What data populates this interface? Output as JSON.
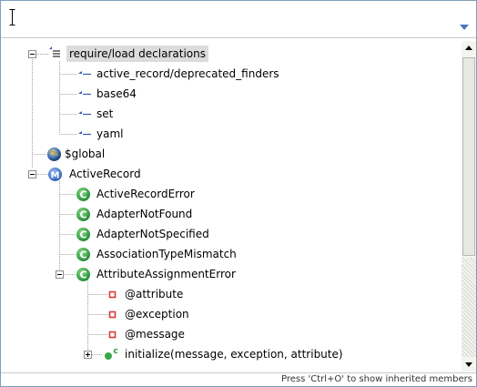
{
  "filter": {
    "value": "",
    "placeholder": ""
  },
  "tree": {
    "nodes": [
      {
        "label": "require/load declarations",
        "icon": "imports-container-icon",
        "selected": true
      },
      {
        "label": "active_record/deprecated_finders",
        "icon": "import-icon"
      },
      {
        "label": "base64",
        "icon": "import-icon"
      },
      {
        "label": "set",
        "icon": "import-icon"
      },
      {
        "label": "yaml",
        "icon": "import-icon"
      },
      {
        "label": "$global",
        "icon": "global-icon"
      },
      {
        "label": "ActiveRecord",
        "icon": "module-icon",
        "badge": "M"
      },
      {
        "label": "ActiveRecordError",
        "icon": "class-icon",
        "badge": "C"
      },
      {
        "label": "AdapterNotFound",
        "icon": "class-icon",
        "badge": "C"
      },
      {
        "label": "AdapterNotSpecified",
        "icon": "class-icon",
        "badge": "C"
      },
      {
        "label": "AssociationTypeMismatch",
        "icon": "class-icon",
        "badge": "C"
      },
      {
        "label": "AttributeAssignmentError",
        "icon": "class-icon",
        "badge": "C"
      },
      {
        "label": "@attribute",
        "icon": "field-icon"
      },
      {
        "label": "@exception",
        "icon": "field-icon"
      },
      {
        "label": "@message",
        "icon": "field-icon"
      },
      {
        "label": "initialize(message, exception, attribute)",
        "icon": "constructor-icon",
        "badge": "c"
      }
    ]
  },
  "status": {
    "hint": "Press 'Ctrl+O' to show inherited members"
  },
  "colors": {
    "border": "#7f9db9",
    "class_green": "#2e9e3e",
    "module_blue": "#3a6fc4",
    "field_red": "#d63b3b",
    "import_blue": "#3257b5",
    "selection": "#dcdcdc",
    "guide": "#a0a0a0"
  }
}
